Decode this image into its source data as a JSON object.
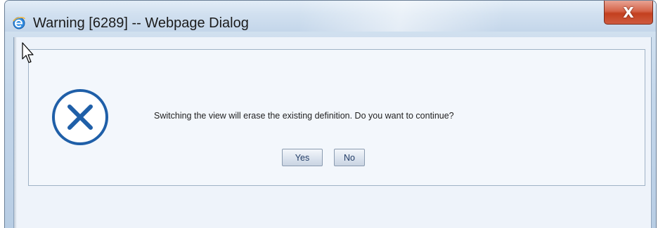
{
  "window": {
    "title": "Warning [6289] -- Webpage Dialog",
    "close_label": "X",
    "app_icon": "ie-icon",
    "close_icon": "close-icon"
  },
  "dialog": {
    "icon": "error-icon",
    "message": "Switching the view will erase the existing definition. Do you want to continue?",
    "buttons": {
      "yes_label": "Yes",
      "no_label": "No"
    }
  },
  "colors": {
    "icon_blue": "#1f5fa8",
    "close_red": "#c3401f",
    "button_text": "#223c66"
  }
}
